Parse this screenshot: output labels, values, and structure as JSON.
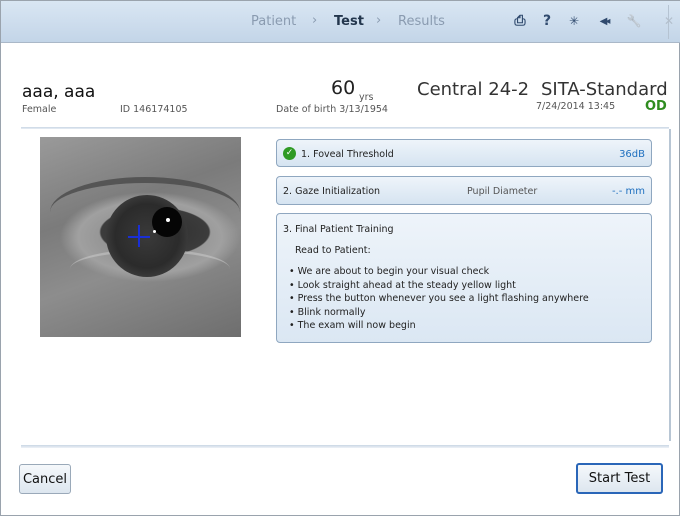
{
  "nav": {
    "crumbs": [
      "Patient",
      "Test",
      "Results"
    ],
    "separator": "›",
    "active_crumb": "Test"
  },
  "toolbar": {
    "icons": [
      "printer-icon",
      "help-icon",
      "brightness-icon",
      "volume-icon",
      "wrench-icon",
      "close-icon"
    ],
    "print_glyph": "⎙",
    "help_glyph": "?",
    "brightness_glyph": "✳",
    "volume_glyph": "◀◂",
    "wrench_glyph": "🔧",
    "close_glyph": "✕"
  },
  "patient": {
    "name": "aaa, aaa",
    "gender": "Female",
    "id_label": "ID 146174105",
    "age": "60",
    "age_unit": "yrs",
    "dob": "Date of birth  3/13/1954"
  },
  "test": {
    "pattern": "Central 24-2",
    "strategy": "SITA-Standard",
    "datetime": "7/24/2014 13:45",
    "eye": "OD"
  },
  "steps": {
    "foveal": {
      "label": "1. Foveal Threshold",
      "value": "36dB",
      "status": "complete"
    },
    "gaze": {
      "label": "2. Gaze Initialization",
      "pupil_label": "Pupil Diameter",
      "pupil_value": "-.- mm"
    },
    "training": {
      "label": "3. Final Patient Training",
      "read_to": "Read to Patient:",
      "instructions": [
        "• We are about to begin your visual check",
        "• Look straight ahead at the steady yellow light",
        "• Press the button whenever you see a light flashing anywhere",
        "• Blink normally",
        "• The exam will now begin"
      ]
    }
  },
  "buttons": {
    "cancel": "Cancel",
    "start": "Start Test"
  },
  "colors": {
    "accent": "#2a66b8",
    "eye_od": "#2f8c1f",
    "check": "#2f9a24",
    "value": "#1e6fbf"
  }
}
